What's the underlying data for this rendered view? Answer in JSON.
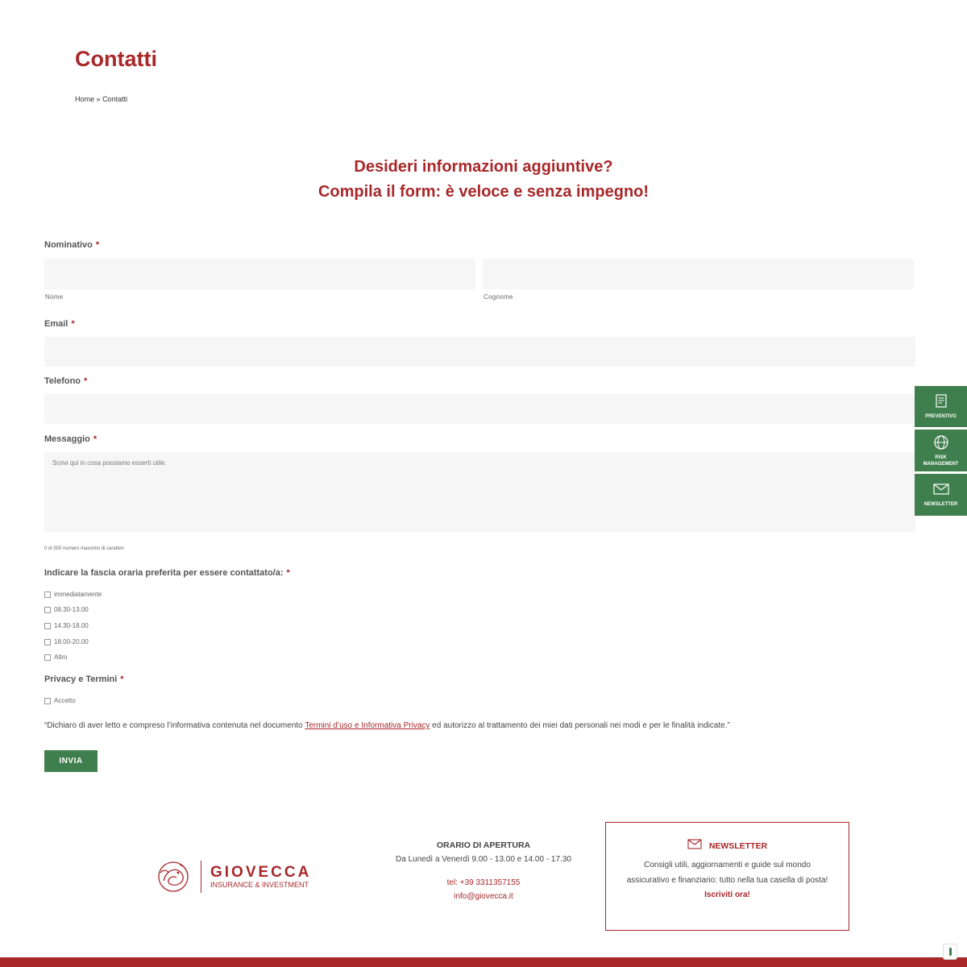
{
  "page": {
    "title": "Contatti",
    "breadcrumb": {
      "home": "Home",
      "sep": "»",
      "current": "Contatti"
    }
  },
  "intro": {
    "line1": "Desideri informazioni aggiuntive?",
    "line2": "Compila il form: è veloce e senza impegno!"
  },
  "form": {
    "required_mark": "*",
    "nominativo": {
      "label": "Nominativo",
      "first_sub": "Nome",
      "last_sub": "Cognome"
    },
    "email": {
      "label": "Email"
    },
    "telefono": {
      "label": "Telefono"
    },
    "messaggio": {
      "label": "Messaggio",
      "placeholder": "Scrivi qui in cosa possiamo esserti utile.",
      "counter": "0 di 500 numero massimo di caratteri"
    },
    "fascia": {
      "label": "Indicare la fascia oraria preferita per essere contattato/a:",
      "options": [
        "immediatamente",
        "08.30-13.00",
        "14.30-18.00",
        "18.00-20.00",
        "Altro"
      ]
    },
    "privacy": {
      "label": "Privacy e Termini",
      "option": "Accetto"
    },
    "declaration": {
      "before": "“Dichiaro di aver letto e compreso l’informativa contenuta nel documento ",
      "link": "Termini d’uso e Informativa Privacy",
      "after": " ed autorizzo al trattamento dei miei dati personali nei modi e per le finalità indicate.”"
    },
    "submit_label": "INVIA"
  },
  "side_tabs": [
    {
      "label": "PREVENTIVO",
      "icon": "document-icon"
    },
    {
      "label": "RISK MANAGEMENT",
      "icon": "network-globe-icon"
    },
    {
      "label": "NEWSLETTER",
      "icon": "envelope-icon"
    }
  ],
  "footer": {
    "brand": {
      "name": "GIOVECCA",
      "tagline": "INSURANCE & INVESTMENT"
    },
    "hours": {
      "title": "ORARIO DI APERTURA",
      "text": "Da Lunedì a Venerdì 9.00 - 13.00 e 14.00 - 17.30",
      "phone": "tel: +39 3311357155",
      "email": "info@giovecca.it"
    },
    "newsletter": {
      "title": "NEWSLETTER",
      "text": "Consigli utili, aggiornamenti e guide sul mondo assicurativo e finanziario: tutto nella tua casella di posta!",
      "cta": "Iscriviti ora!"
    }
  },
  "colors": {
    "brand_red": "#a8282a",
    "brand_green": "#3f7f4d",
    "field_bg": "#f6f6f6"
  }
}
